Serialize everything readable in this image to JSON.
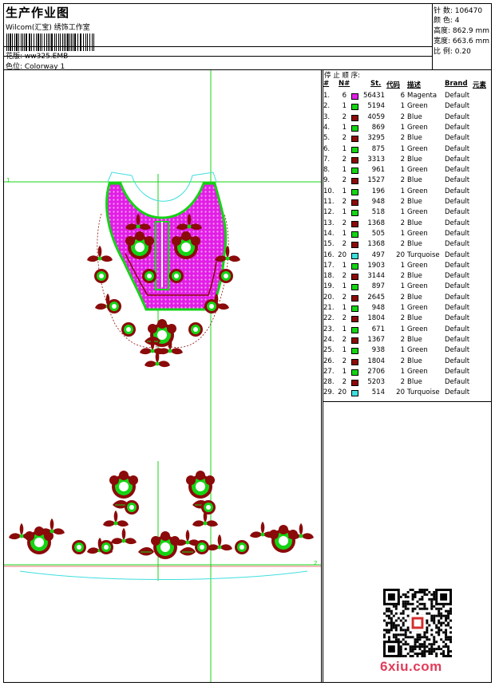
{
  "header": {
    "title": "生产作业图",
    "subtitle": "Wilcom(汇宝) 绣饰工作室",
    "design_label": "花版: ww325.EMB",
    "colorway_label": "色位:  Colorway 1"
  },
  "stats": {
    "stitches": "针 数:  106470",
    "colors": "颜 色:  4",
    "height": "高度:  862.9 mm",
    "width": "宽度:  663.6 mm",
    "scale": "比 例:  0.20"
  },
  "stops": {
    "caption": "停 止 顺 序:",
    "headers": {
      "no": "#",
      "n": "N#",
      "st": "St.",
      "code": "代码",
      "desc": "描述",
      "brand": "Brand",
      "elem": "元素"
    },
    "colors": {
      "Magenta": "#e21ee6",
      "Green": "#14d414",
      "Blue": "#8b0a0a",
      "Turquoise": "#3fdede"
    },
    "rows": [
      {
        "no": "1.",
        "n": "6",
        "st": "56431",
        "code": "6",
        "desc": "Magenta",
        "brand": "Default"
      },
      {
        "no": "2.",
        "n": "1",
        "st": "5194",
        "code": "1",
        "desc": "Green",
        "brand": "Default"
      },
      {
        "no": "3.",
        "n": "2",
        "st": "4059",
        "code": "2",
        "desc": "Blue",
        "brand": "Default"
      },
      {
        "no": "4.",
        "n": "1",
        "st": "869",
        "code": "1",
        "desc": "Green",
        "brand": "Default"
      },
      {
        "no": "5.",
        "n": "2",
        "st": "3295",
        "code": "2",
        "desc": "Blue",
        "brand": "Default"
      },
      {
        "no": "6.",
        "n": "1",
        "st": "875",
        "code": "1",
        "desc": "Green",
        "brand": "Default"
      },
      {
        "no": "7.",
        "n": "2",
        "st": "3313",
        "code": "2",
        "desc": "Blue",
        "brand": "Default"
      },
      {
        "no": "8.",
        "n": "1",
        "st": "961",
        "code": "1",
        "desc": "Green",
        "brand": "Default"
      },
      {
        "no": "9.",
        "n": "2",
        "st": "1527",
        "code": "2",
        "desc": "Blue",
        "brand": "Default"
      },
      {
        "no": "10.",
        "n": "1",
        "st": "196",
        "code": "1",
        "desc": "Green",
        "brand": "Default"
      },
      {
        "no": "11.",
        "n": "2",
        "st": "948",
        "code": "2",
        "desc": "Blue",
        "brand": "Default"
      },
      {
        "no": "12.",
        "n": "1",
        "st": "518",
        "code": "1",
        "desc": "Green",
        "brand": "Default"
      },
      {
        "no": "13.",
        "n": "2",
        "st": "1368",
        "code": "2",
        "desc": "Blue",
        "brand": "Default"
      },
      {
        "no": "14.",
        "n": "1",
        "st": "505",
        "code": "1",
        "desc": "Green",
        "brand": "Default"
      },
      {
        "no": "15.",
        "n": "2",
        "st": "1368",
        "code": "2",
        "desc": "Blue",
        "brand": "Default"
      },
      {
        "no": "16.",
        "n": "20",
        "st": "497",
        "code": "20",
        "desc": "Turquoise",
        "brand": "Default"
      },
      {
        "no": "17.",
        "n": "1",
        "st": "1903",
        "code": "1",
        "desc": "Green",
        "brand": "Default"
      },
      {
        "no": "18.",
        "n": "2",
        "st": "3144",
        "code": "2",
        "desc": "Blue",
        "brand": "Default"
      },
      {
        "no": "19.",
        "n": "1",
        "st": "897",
        "code": "1",
        "desc": "Green",
        "brand": "Default"
      },
      {
        "no": "20.",
        "n": "2",
        "st": "2645",
        "code": "2",
        "desc": "Blue",
        "brand": "Default"
      },
      {
        "no": "21.",
        "n": "1",
        "st": "948",
        "code": "1",
        "desc": "Green",
        "brand": "Default"
      },
      {
        "no": "22.",
        "n": "2",
        "st": "1804",
        "code": "2",
        "desc": "Blue",
        "brand": "Default"
      },
      {
        "no": "23.",
        "n": "1",
        "st": "671",
        "code": "1",
        "desc": "Green",
        "brand": "Default"
      },
      {
        "no": "24.",
        "n": "2",
        "st": "1367",
        "code": "2",
        "desc": "Blue",
        "brand": "Default"
      },
      {
        "no": "25.",
        "n": "1",
        "st": "938",
        "code": "1",
        "desc": "Green",
        "brand": "Default"
      },
      {
        "no": "26.",
        "n": "2",
        "st": "1804",
        "code": "2",
        "desc": "Blue",
        "brand": "Default"
      },
      {
        "no": "27.",
        "n": "1",
        "st": "2706",
        "code": "1",
        "desc": "Green",
        "brand": "Default"
      },
      {
        "no": "28.",
        "n": "2",
        "st": "5203",
        "code": "2",
        "desc": "Blue",
        "brand": "Default"
      },
      {
        "no": "29.",
        "n": "20",
        "st": "514",
        "code": "20",
        "desc": "Turquoise",
        "brand": "Default"
      }
    ]
  },
  "watermark": "6xiu.com"
}
